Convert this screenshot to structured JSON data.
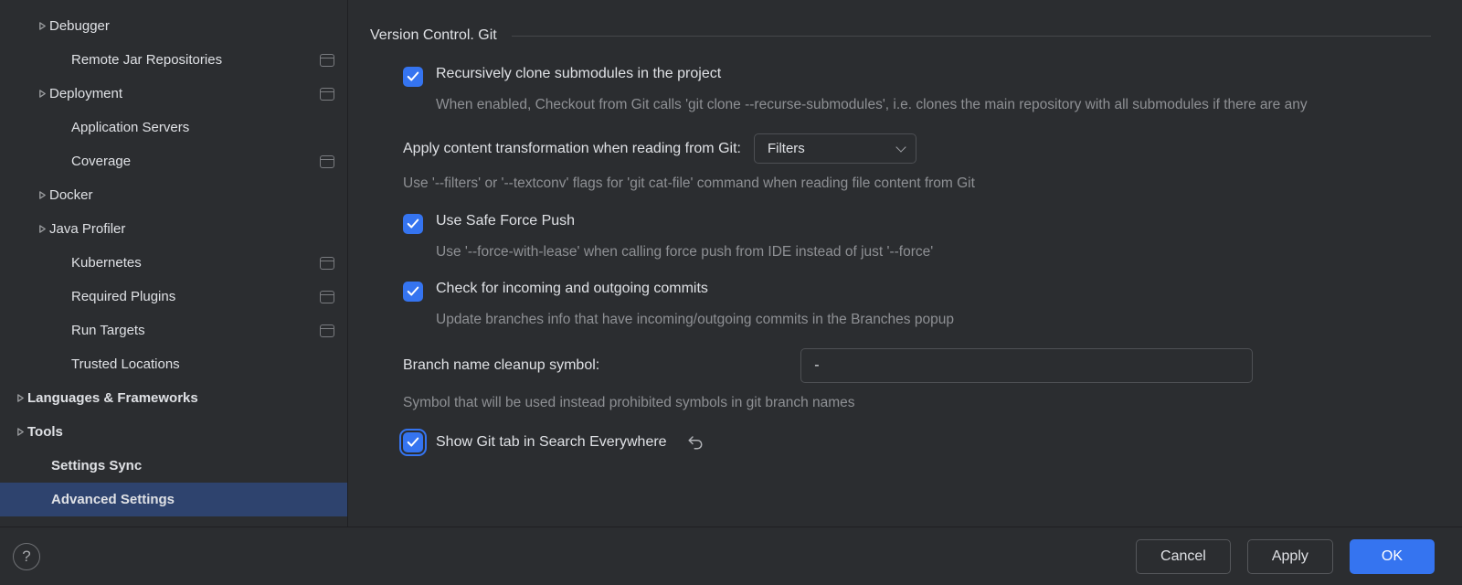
{
  "sidebar": {
    "items": [
      {
        "label": "Debugger",
        "indent": "indent-1",
        "arrow": true,
        "icon": false,
        "bold": false
      },
      {
        "label": "Remote Jar Repositories",
        "indent": "indent-2",
        "arrow": false,
        "icon": true,
        "bold": false
      },
      {
        "label": "Deployment",
        "indent": "indent-1",
        "arrow": true,
        "icon": true,
        "bold": false
      },
      {
        "label": "Application Servers",
        "indent": "indent-2",
        "arrow": false,
        "icon": false,
        "bold": false
      },
      {
        "label": "Coverage",
        "indent": "indent-2",
        "arrow": false,
        "icon": true,
        "bold": false
      },
      {
        "label": "Docker",
        "indent": "indent-1",
        "arrow": true,
        "icon": false,
        "bold": false
      },
      {
        "label": "Java Profiler",
        "indent": "indent-1",
        "arrow": true,
        "icon": false,
        "bold": false
      },
      {
        "label": "Kubernetes",
        "indent": "indent-2",
        "arrow": false,
        "icon": true,
        "bold": false
      },
      {
        "label": "Required Plugins",
        "indent": "indent-2",
        "arrow": false,
        "icon": true,
        "bold": false
      },
      {
        "label": "Run Targets",
        "indent": "indent-2",
        "arrow": false,
        "icon": true,
        "bold": false
      },
      {
        "label": "Trusted Locations",
        "indent": "indent-2",
        "arrow": false,
        "icon": false,
        "bold": false
      },
      {
        "label": "Languages & Frameworks",
        "indent": "indent-0",
        "arrow": true,
        "icon": false,
        "bold": true
      },
      {
        "label": "Tools",
        "indent": "indent-0",
        "arrow": true,
        "icon": false,
        "bold": true
      },
      {
        "label": "Settings Sync",
        "indent": "indent-0b",
        "arrow": false,
        "icon": false,
        "bold": true
      },
      {
        "label": "Advanced Settings",
        "indent": "indent-0b",
        "arrow": false,
        "icon": false,
        "bold": true,
        "selected": true
      }
    ]
  },
  "content": {
    "title": "Version Control. Git",
    "opt1_label": "Recursively clone submodules in the project",
    "opt1_desc": "When enabled, Checkout from Git calls 'git clone --recurse-submodules', i.e. clones the main repository with all submodules if there are any",
    "transform_label": "Apply content transformation when reading from Git:",
    "transform_value": "Filters",
    "transform_desc": "Use '--filters' or '--textconv' flags for 'git cat-file' command when reading file content from Git",
    "opt2_label": "Use Safe Force Push",
    "opt2_desc": "Use '--force-with-lease' when calling force push from IDE instead of just '--force'",
    "opt3_label": "Check for incoming and outgoing commits",
    "opt3_desc": "Update branches info that have incoming/outgoing commits in the Branches popup",
    "cleanup_label": "Branch name cleanup symbol:",
    "cleanup_value": "-",
    "cleanup_desc": "Symbol that will be used instead prohibited symbols in git branch names",
    "opt4_label": "Show Git tab in Search Everywhere"
  },
  "footer": {
    "help": "?",
    "cancel": "Cancel",
    "apply": "Apply",
    "ok": "OK"
  }
}
